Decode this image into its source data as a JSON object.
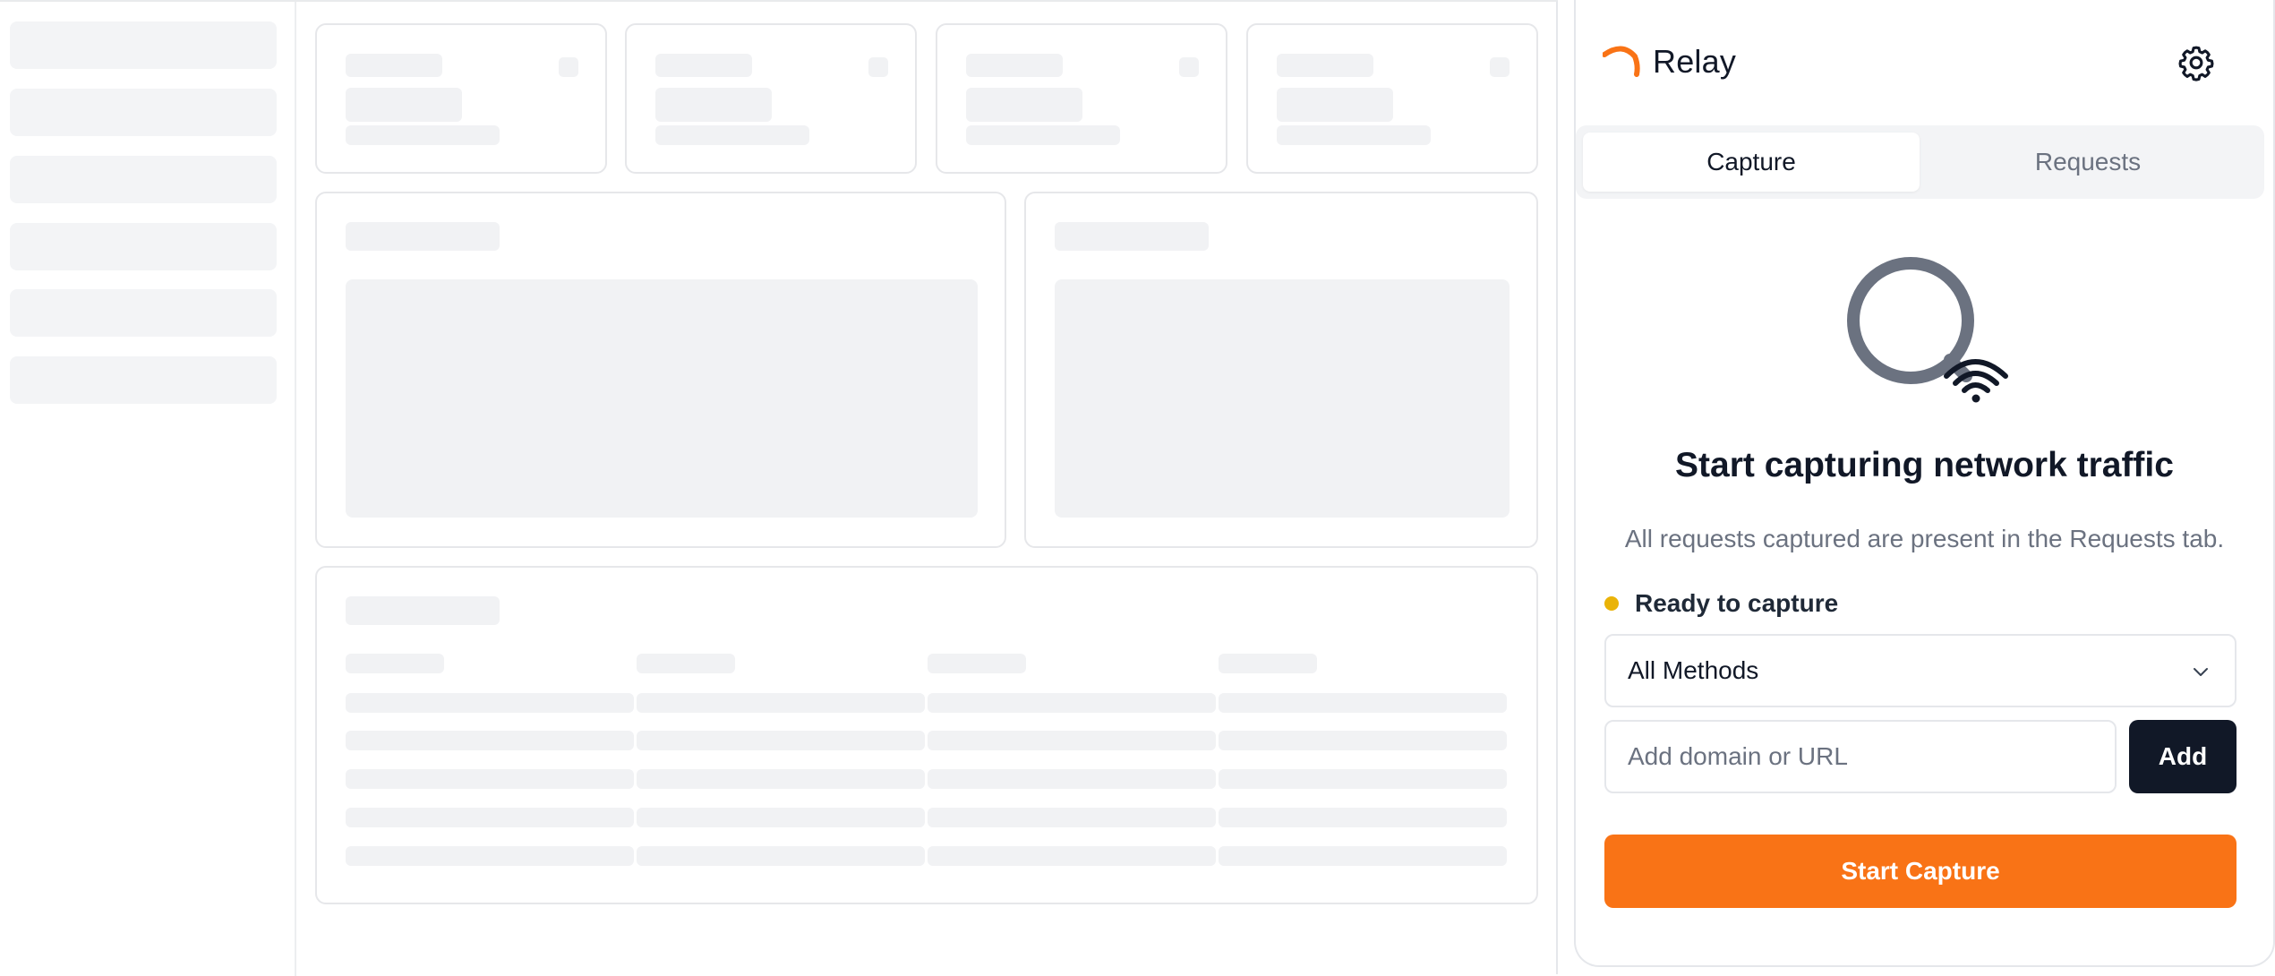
{
  "app_skeleton": {
    "description_hidden": ""
  },
  "panel": {
    "brand": {
      "name": "Relay",
      "accent_color": "#f97316",
      "logo_icon": "relay-logo-icon"
    },
    "settings_icon": "gear-icon",
    "tabs": [
      {
        "label": "Capture",
        "active": true
      },
      {
        "label": "Requests",
        "active": false
      }
    ],
    "hero_icon": "magnifier-wifi-icon",
    "headline": "Start capturing network traffic",
    "subline": "All requests captured are present in the Requests tab.",
    "status": {
      "label": "Ready to capture",
      "color": "#eab308"
    },
    "method_select": {
      "value": "All Methods",
      "icon": "chevron-down-icon"
    },
    "url_input": {
      "placeholder": "Add domain or URL",
      "value": ""
    },
    "add_button": {
      "label": "Add",
      "color": "#111827"
    },
    "start_button": {
      "label": "Start Capture",
      "color": "#f97316"
    }
  }
}
